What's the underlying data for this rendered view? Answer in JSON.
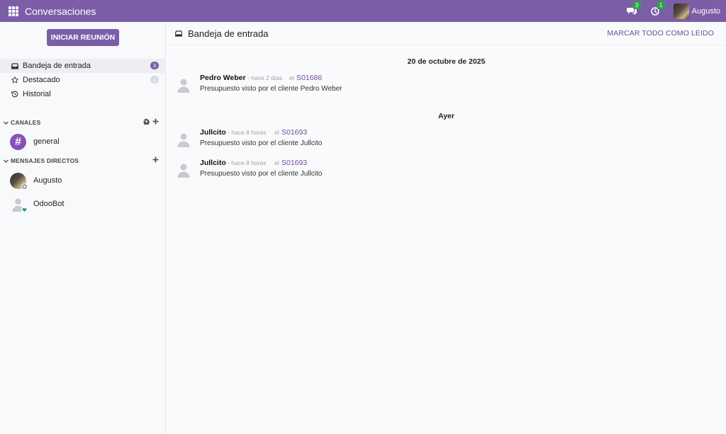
{
  "navbar": {
    "app_title": "Conversaciones",
    "messages_count": "3",
    "activities_count": "1",
    "user_name": "Augusto",
    "accent_color": "#7b5ea7"
  },
  "sidebar": {
    "start_meeting_label": "INICIAR REUNIÓN",
    "mailboxes": [
      {
        "label": "Bandeja de entrada",
        "icon": "inbox-icon",
        "counter": "3"
      },
      {
        "label": "Destacado",
        "icon": "star-icon",
        "counter": "1"
      },
      {
        "label": "Historial",
        "icon": "history-icon"
      }
    ],
    "channels_label": "CANALES",
    "channels": [
      {
        "name": "general",
        "icon": "hash-icon"
      }
    ],
    "direct_label": "MENSAJES DIRECTOS",
    "direct": [
      {
        "name": "Augusto"
      },
      {
        "name": "OdooBot"
      }
    ]
  },
  "thread": {
    "title": "Bandeja de entrada",
    "mark_all_read_label": "MARCAR TODO COMO LEIDO",
    "groups": [
      {
        "date": "20 de octubre de 2025",
        "messages": [
          {
            "author": "Pedro Weber",
            "time": "- hace 2 días",
            "on": "el",
            "record": "S01686",
            "body": "Presupuesto visto por el cliente Pedro Weber"
          }
        ]
      },
      {
        "date": "Ayer",
        "messages": [
          {
            "author": "Jullcito",
            "time": "- hace 8 horas",
            "on": "el",
            "record": "S01693",
            "body": "Presupuesto visto por el cliente Jullcito"
          },
          {
            "author": "Jullcito",
            "time": "- hace 8 horas",
            "on": "el",
            "record": "S01693",
            "body": "Presupuesto visto por el cliente Jullcito"
          }
        ]
      }
    ]
  }
}
